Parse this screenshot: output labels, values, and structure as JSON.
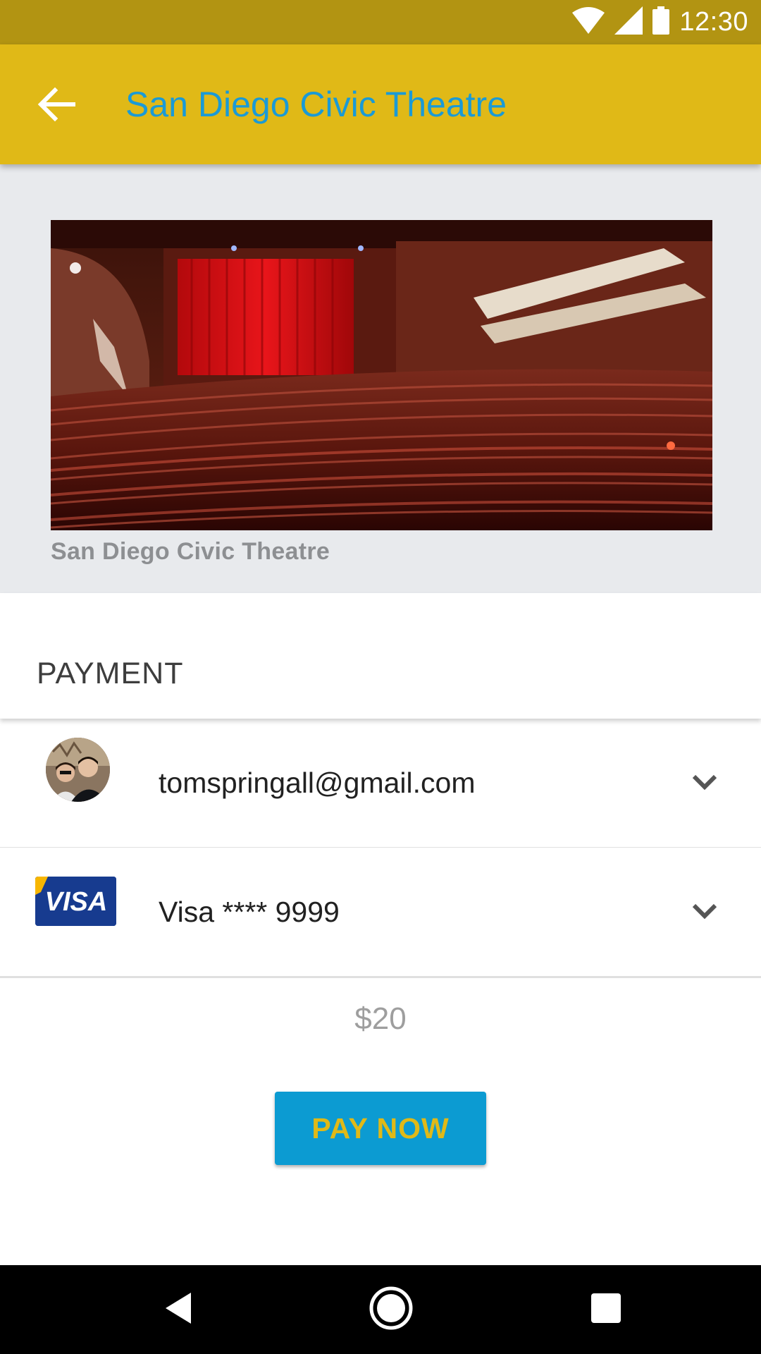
{
  "status_bar": {
    "time": "12:30",
    "icons": [
      "wifi-icon",
      "cell-signal-icon",
      "battery-icon"
    ]
  },
  "app_bar": {
    "title": "San Diego Civic Theatre",
    "back_icon": "arrow-back-icon"
  },
  "hero": {
    "image_subject": "theatre auditorium with red curtain and seats",
    "caption": "San Diego Civic Theatre"
  },
  "payment": {
    "title": "PAYMENT",
    "account": {
      "email": "tomspringall@gmail.com",
      "icon": "chevron-down-icon"
    },
    "card": {
      "logo_text": "VISA",
      "label": "Visa **** 9999",
      "icon": "chevron-down-icon"
    },
    "price": "$20",
    "pay_button": "PAY NOW"
  },
  "nav_bar": {
    "icons": [
      "nav-back-icon",
      "nav-home-icon",
      "nav-recents-icon"
    ]
  },
  "colors": {
    "status_bar": "#b29412",
    "app_bar": "#e0b917",
    "title_text": "#1a9ad6",
    "button_bg": "#0c9bd2",
    "button_text": "#e0b917",
    "hero_bg": "#e8eaed",
    "visa_blue": "#173b8f",
    "visa_gold": "#f7b600"
  }
}
